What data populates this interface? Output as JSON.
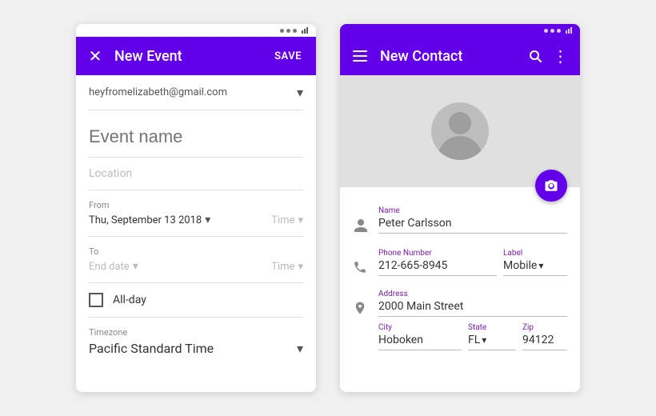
{
  "event_card": {
    "status_bar": {
      "dots": [
        "dot1",
        "dot2",
        "dot3"
      ]
    },
    "app_bar": {
      "title": "New Event",
      "close_icon": "✕",
      "save_label": "SAVE"
    },
    "account": {
      "email": "heyfromelizabeth@gmail.com"
    },
    "event_name_placeholder": "Event name",
    "location_label": "Location",
    "from_section": {
      "label": "From",
      "date_value": "Thu, September 13 2018",
      "time_placeholder": "Time"
    },
    "to_section": {
      "label": "To",
      "date_placeholder": "End date",
      "time_placeholder": "Time"
    },
    "allday": {
      "label": "All-day"
    },
    "timezone": {
      "label": "Timezone",
      "value": "Pacific Standard Time"
    }
  },
  "contact_card": {
    "status_bar": {
      "dots": [
        "dot1",
        "dot2",
        "dot3"
      ]
    },
    "app_bar": {
      "menu_icon": "menu",
      "title": "New Contact",
      "search_icon": "🔍",
      "more_icon": "⋮"
    },
    "name_field": {
      "label": "Name",
      "value": "Peter Carlsson"
    },
    "phone_field": {
      "label": "Phone Number",
      "value": "212-665-8945"
    },
    "phone_label": {
      "label": "Label",
      "value": "Mobile"
    },
    "address_field": {
      "label": "Address",
      "value": "2000 Main Street"
    },
    "city_field": {
      "label": "City",
      "value": "Hoboken"
    },
    "state_field": {
      "label": "State",
      "value": "FL"
    },
    "zip_field": {
      "label": "Zip",
      "value": "94122"
    }
  }
}
